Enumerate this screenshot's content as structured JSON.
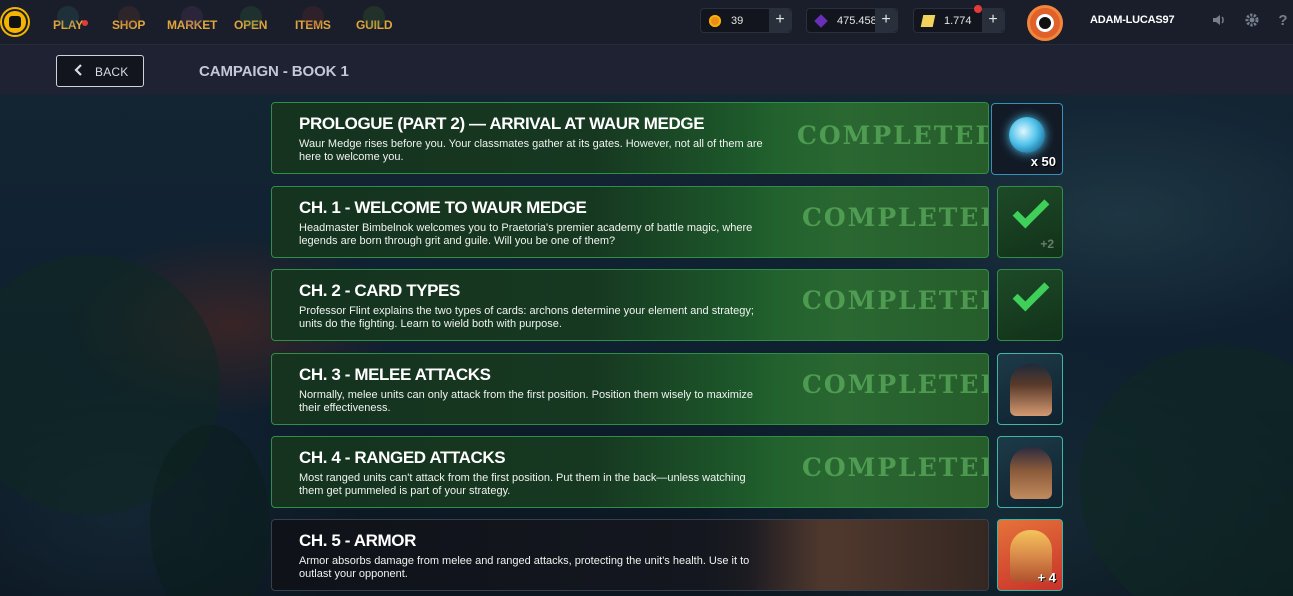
{
  "nav": {
    "items": [
      {
        "label": "PLAY"
      },
      {
        "label": "SHOP"
      },
      {
        "label": "MARKET"
      },
      {
        "label": "OPEN"
      },
      {
        "label": "ITEMS"
      },
      {
        "label": "GUILD"
      }
    ]
  },
  "currencies": {
    "gold": {
      "value": "39",
      "plus": "+"
    },
    "gems": {
      "value": "475.458",
      "plus": "+"
    },
    "scrolls": {
      "value": "1.774",
      "plus": "+"
    }
  },
  "user": {
    "name": "ADAM-LUCAS97"
  },
  "icons": {
    "sound": "speaker-icon",
    "settings": "gear-icon",
    "help": "help-icon"
  },
  "help_glyph": "?",
  "back": {
    "label": "BACK"
  },
  "page_title": "CAMPAIGN - BOOK 1",
  "chapters": [
    {
      "title": "PROLOGUE (PART 2) — ARRIVAL AT WAUR MEDGE",
      "desc": "Waur Medge rises before you. Your classmates gather at its gates. However, not all of them are here to welcome you.",
      "status": "COMPLETED",
      "reward": "x 50"
    },
    {
      "title": "CH. 1 - WELCOME TO WAUR MEDGE",
      "desc": "Headmaster Bimbelnok welcomes you to Praetoria's premier academy of battle magic, where legends are born through grit and guile. Will you be one of them?",
      "status": "COMPLETED",
      "reward": "+2"
    },
    {
      "title": "CH. 2 - CARD TYPES",
      "desc": "Professor Flint explains the two types of cards: archons determine your element and strategy; units do the fighting. Learn to wield both with purpose.",
      "status": "COMPLETED",
      "reward": ""
    },
    {
      "title": "CH. 3 - MELEE ATTACKS",
      "desc": "Normally, melee units can only attack from the first position. Position them wisely to maximize their effectiveness.",
      "status": "COMPLETED",
      "reward": ""
    },
    {
      "title": "CH. 4 - RANGED ATTACKS",
      "desc": "Most ranged units can't attack from the first position. Put them in the back—unless watching them get pummeled is part of your strategy.",
      "status": "COMPLETED",
      "reward": ""
    },
    {
      "title": "CH. 5 - ARMOR",
      "desc": "Armor absorbs damage from melee and ranged attacks, protecting the unit's health. Use it to outlast your opponent.",
      "status": "",
      "reward": "+ 4"
    }
  ],
  "colors": {
    "accent_gold": "#e0a53c",
    "completed_green": "#2f8f47",
    "check_green": "#3fd05a",
    "notification_red": "#e63a3a"
  }
}
